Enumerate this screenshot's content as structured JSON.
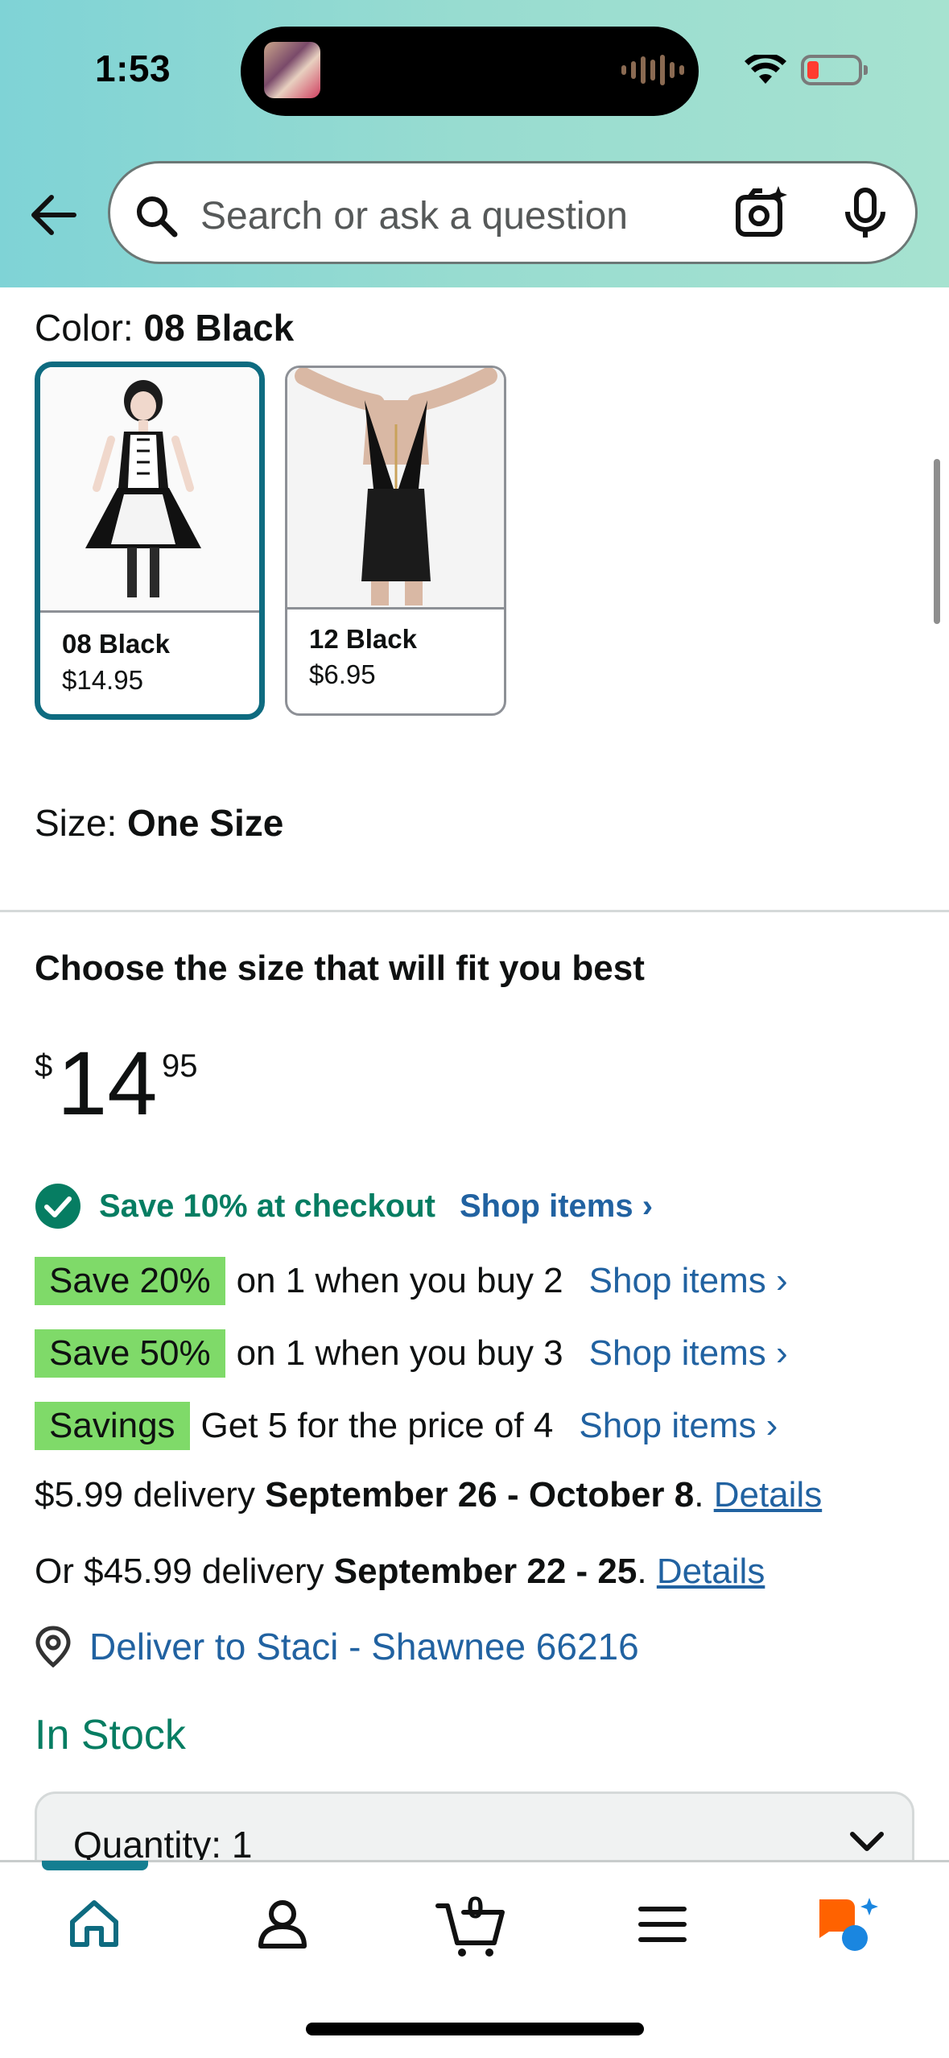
{
  "status_bar": {
    "time": "1:53"
  },
  "search": {
    "placeholder": "Search or ask a question"
  },
  "color": {
    "label": "Color: ",
    "value": "08 Black"
  },
  "swatches": [
    {
      "name": "08 Black",
      "price": "$14.95",
      "selected": true
    },
    {
      "name": "12 Black",
      "price": "$6.95",
      "selected": false
    }
  ],
  "size": {
    "label": "Size: ",
    "value": "One Size"
  },
  "fit_heading": "Choose the size that will fit you best",
  "price": {
    "currency": "$",
    "whole": "14",
    "fraction": "95"
  },
  "checkout_promo": {
    "text": "Save 10% at checkout",
    "link": "Shop items ›"
  },
  "promos": [
    {
      "badge": "Save 20%",
      "desc": "on 1 when you buy 2",
      "link": "Shop items ›"
    },
    {
      "badge": "Save 50%",
      "desc": "on 1 when you buy 3",
      "link": "Shop items ›"
    },
    {
      "badge": "Savings",
      "desc": "Get 5 for the price of 4",
      "link": "Shop items ›"
    }
  ],
  "delivery": [
    {
      "prefix": "$5.99 delivery ",
      "dates": "September 26 - October 8",
      "suffix": ". ",
      "link": "Details"
    },
    {
      "prefix": "Or $45.99 delivery ",
      "dates": "September 22 - 25",
      "suffix": ". ",
      "link": "Details"
    }
  ],
  "deliver_to": "Deliver to Staci - Shawnee 66216",
  "stock": "In Stock",
  "quantity": {
    "label": "Quantity: 1"
  },
  "nav": {
    "cart_count": "0"
  },
  "colors": {
    "accent": "#0e6b80",
    "link": "#2162a1",
    "success": "#067d62",
    "badge": "#7fda69"
  }
}
